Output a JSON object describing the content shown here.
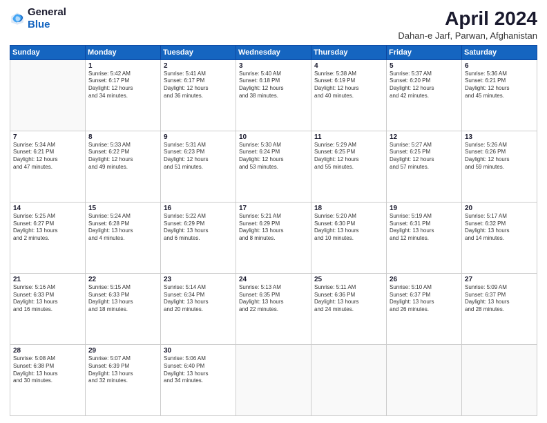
{
  "logo": {
    "general": "General",
    "blue": "Blue"
  },
  "header": {
    "title": "April 2024",
    "subtitle": "Dahan-e Jarf, Parwan, Afghanistan"
  },
  "weekdays": [
    "Sunday",
    "Monday",
    "Tuesday",
    "Wednesday",
    "Thursday",
    "Friday",
    "Saturday"
  ],
  "weeks": [
    [
      {
        "day": "",
        "sunrise": "",
        "sunset": "",
        "daylight": ""
      },
      {
        "day": "1",
        "sunrise": "Sunrise: 5:42 AM",
        "sunset": "Sunset: 6:17 PM",
        "daylight": "Daylight: 12 hours and 34 minutes."
      },
      {
        "day": "2",
        "sunrise": "Sunrise: 5:41 AM",
        "sunset": "Sunset: 6:17 PM",
        "daylight": "Daylight: 12 hours and 36 minutes."
      },
      {
        "day": "3",
        "sunrise": "Sunrise: 5:40 AM",
        "sunset": "Sunset: 6:18 PM",
        "daylight": "Daylight: 12 hours and 38 minutes."
      },
      {
        "day": "4",
        "sunrise": "Sunrise: 5:38 AM",
        "sunset": "Sunset: 6:19 PM",
        "daylight": "Daylight: 12 hours and 40 minutes."
      },
      {
        "day": "5",
        "sunrise": "Sunrise: 5:37 AM",
        "sunset": "Sunset: 6:20 PM",
        "daylight": "Daylight: 12 hours and 42 minutes."
      },
      {
        "day": "6",
        "sunrise": "Sunrise: 5:36 AM",
        "sunset": "Sunset: 6:21 PM",
        "daylight": "Daylight: 12 hours and 45 minutes."
      }
    ],
    [
      {
        "day": "7",
        "sunrise": "Sunrise: 5:34 AM",
        "sunset": "Sunset: 6:21 PM",
        "daylight": "Daylight: 12 hours and 47 minutes."
      },
      {
        "day": "8",
        "sunrise": "Sunrise: 5:33 AM",
        "sunset": "Sunset: 6:22 PM",
        "daylight": "Daylight: 12 hours and 49 minutes."
      },
      {
        "day": "9",
        "sunrise": "Sunrise: 5:31 AM",
        "sunset": "Sunset: 6:23 PM",
        "daylight": "Daylight: 12 hours and 51 minutes."
      },
      {
        "day": "10",
        "sunrise": "Sunrise: 5:30 AM",
        "sunset": "Sunset: 6:24 PM",
        "daylight": "Daylight: 12 hours and 53 minutes."
      },
      {
        "day": "11",
        "sunrise": "Sunrise: 5:29 AM",
        "sunset": "Sunset: 6:25 PM",
        "daylight": "Daylight: 12 hours and 55 minutes."
      },
      {
        "day": "12",
        "sunrise": "Sunrise: 5:27 AM",
        "sunset": "Sunset: 6:25 PM",
        "daylight": "Daylight: 12 hours and 57 minutes."
      },
      {
        "day": "13",
        "sunrise": "Sunrise: 5:26 AM",
        "sunset": "Sunset: 6:26 PM",
        "daylight": "Daylight: 12 hours and 59 minutes."
      }
    ],
    [
      {
        "day": "14",
        "sunrise": "Sunrise: 5:25 AM",
        "sunset": "Sunset: 6:27 PM",
        "daylight": "Daylight: 13 hours and 2 minutes."
      },
      {
        "day": "15",
        "sunrise": "Sunrise: 5:24 AM",
        "sunset": "Sunset: 6:28 PM",
        "daylight": "Daylight: 13 hours and 4 minutes."
      },
      {
        "day": "16",
        "sunrise": "Sunrise: 5:22 AM",
        "sunset": "Sunset: 6:29 PM",
        "daylight": "Daylight: 13 hours and 6 minutes."
      },
      {
        "day": "17",
        "sunrise": "Sunrise: 5:21 AM",
        "sunset": "Sunset: 6:29 PM",
        "daylight": "Daylight: 13 hours and 8 minutes."
      },
      {
        "day": "18",
        "sunrise": "Sunrise: 5:20 AM",
        "sunset": "Sunset: 6:30 PM",
        "daylight": "Daylight: 13 hours and 10 minutes."
      },
      {
        "day": "19",
        "sunrise": "Sunrise: 5:19 AM",
        "sunset": "Sunset: 6:31 PM",
        "daylight": "Daylight: 13 hours and 12 minutes."
      },
      {
        "day": "20",
        "sunrise": "Sunrise: 5:17 AM",
        "sunset": "Sunset: 6:32 PM",
        "daylight": "Daylight: 13 hours and 14 minutes."
      }
    ],
    [
      {
        "day": "21",
        "sunrise": "Sunrise: 5:16 AM",
        "sunset": "Sunset: 6:33 PM",
        "daylight": "Daylight: 13 hours and 16 minutes."
      },
      {
        "day": "22",
        "sunrise": "Sunrise: 5:15 AM",
        "sunset": "Sunset: 6:33 PM",
        "daylight": "Daylight: 13 hours and 18 minutes."
      },
      {
        "day": "23",
        "sunrise": "Sunrise: 5:14 AM",
        "sunset": "Sunset: 6:34 PM",
        "daylight": "Daylight: 13 hours and 20 minutes."
      },
      {
        "day": "24",
        "sunrise": "Sunrise: 5:13 AM",
        "sunset": "Sunset: 6:35 PM",
        "daylight": "Daylight: 13 hours and 22 minutes."
      },
      {
        "day": "25",
        "sunrise": "Sunrise: 5:11 AM",
        "sunset": "Sunset: 6:36 PM",
        "daylight": "Daylight: 13 hours and 24 minutes."
      },
      {
        "day": "26",
        "sunrise": "Sunrise: 5:10 AM",
        "sunset": "Sunset: 6:37 PM",
        "daylight": "Daylight: 13 hours and 26 minutes."
      },
      {
        "day": "27",
        "sunrise": "Sunrise: 5:09 AM",
        "sunset": "Sunset: 6:37 PM",
        "daylight": "Daylight: 13 hours and 28 minutes."
      }
    ],
    [
      {
        "day": "28",
        "sunrise": "Sunrise: 5:08 AM",
        "sunset": "Sunset: 6:38 PM",
        "daylight": "Daylight: 13 hours and 30 minutes."
      },
      {
        "day": "29",
        "sunrise": "Sunrise: 5:07 AM",
        "sunset": "Sunset: 6:39 PM",
        "daylight": "Daylight: 13 hours and 32 minutes."
      },
      {
        "day": "30",
        "sunrise": "Sunrise: 5:06 AM",
        "sunset": "Sunset: 6:40 PM",
        "daylight": "Daylight: 13 hours and 34 minutes."
      },
      {
        "day": "",
        "sunrise": "",
        "sunset": "",
        "daylight": ""
      },
      {
        "day": "",
        "sunrise": "",
        "sunset": "",
        "daylight": ""
      },
      {
        "day": "",
        "sunrise": "",
        "sunset": "",
        "daylight": ""
      },
      {
        "day": "",
        "sunrise": "",
        "sunset": "",
        "daylight": ""
      }
    ]
  ]
}
